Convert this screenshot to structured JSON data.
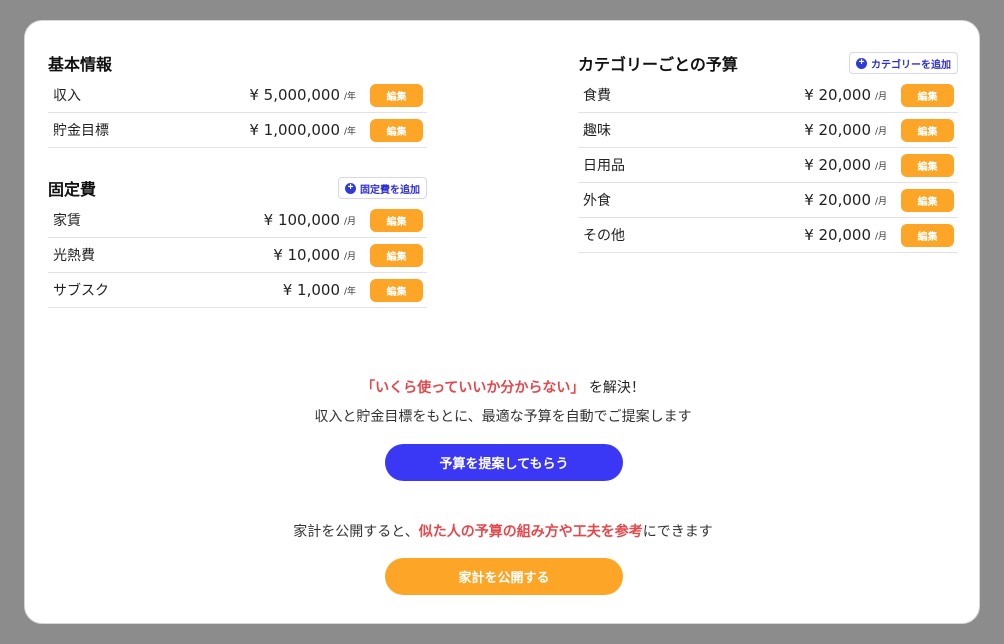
{
  "basic": {
    "title": "基本情報",
    "rows": [
      {
        "label": "収入",
        "amount": "¥ 5,000,000",
        "unit": "/年",
        "edit": "編集"
      },
      {
        "label": "貯金目標",
        "amount": "¥ 1,000,000",
        "unit": "/年",
        "edit": "編集"
      }
    ]
  },
  "fixed": {
    "title": "固定費",
    "add_label": "固定費を追加",
    "rows": [
      {
        "label": "家賃",
        "amount": "¥ 100,000",
        "unit": "/月",
        "edit": "編集"
      },
      {
        "label": "光熱費",
        "amount": "¥ 10,000",
        "unit": "/月",
        "edit": "編集"
      },
      {
        "label": "サブスク",
        "amount": "¥ 1,000",
        "unit": "/年",
        "edit": "編集"
      }
    ]
  },
  "category": {
    "title": "カテゴリーごとの予算",
    "add_label": "カテゴリーを追加",
    "rows": [
      {
        "label": "食費",
        "amount": "¥ 20,000",
        "unit": "/月",
        "edit": "編集"
      },
      {
        "label": "趣味",
        "amount": "¥ 20,000",
        "unit": "/月",
        "edit": "編集"
      },
      {
        "label": "日用品",
        "amount": "¥ 20,000",
        "unit": "/月",
        "edit": "編集"
      },
      {
        "label": "外食",
        "amount": "¥ 20,000",
        "unit": "/月",
        "edit": "編集"
      },
      {
        "label": "その他",
        "amount": "¥ 20,000",
        "unit": "/月",
        "edit": "編集"
      }
    ]
  },
  "suggest": {
    "highlight": "「いくら使っていいか分からない」",
    "after": "を解決！",
    "desc": "収入と貯金目標をもとに、最適な予算を自動でご提案します",
    "button": "予算を提案してもらう"
  },
  "publish": {
    "before": "家計を公開すると、",
    "highlight": "似た人の予算の組み方や工夫を参考",
    "after": "にできます",
    "button": "家計を公開する"
  },
  "colors": {
    "accent_orange": "#fca526",
    "accent_blue": "#3b38f5",
    "highlight_red": "#e5474b"
  }
}
